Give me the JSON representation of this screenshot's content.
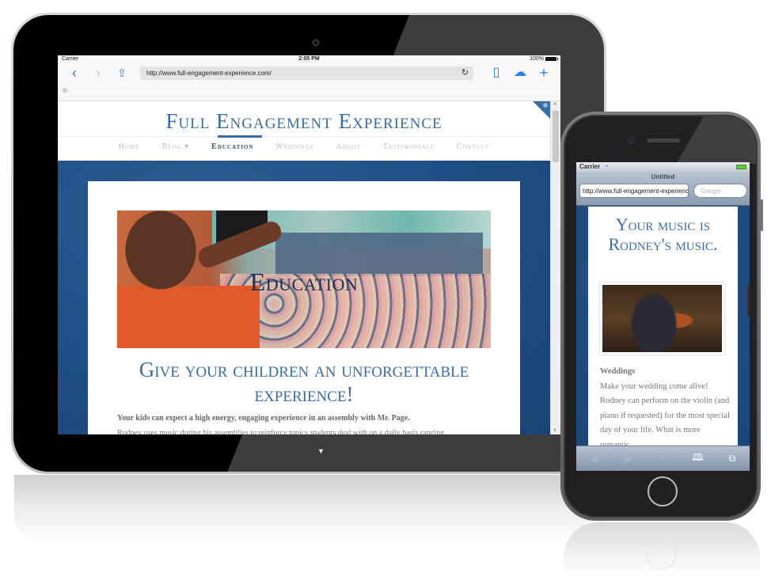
{
  "ipad": {
    "status_bar": {
      "carrier": "Carrier",
      "time": "2:05 PM",
      "battery": "100%"
    },
    "toolbar": {
      "back_icon": "‹",
      "forward_icon": "›",
      "share_icon": "⇪",
      "url": "http://www.full-engagement-experience.com/",
      "reload_icon": "↻",
      "bookmarks_icon": "▯",
      "icloud_icon": "☁",
      "new_tab_icon": "+"
    },
    "tabs_row": {
      "close_icon": "⊗"
    },
    "site": {
      "title": "Full Engagement Experience",
      "nav": [
        "Home",
        "Blog ▾",
        "Education",
        "Weddings",
        "About",
        "Testimonials",
        "Contact"
      ],
      "active_nav": "Education",
      "hero_title": "Education",
      "heading": "Give your children an unforgettable experience!",
      "lead_text": "Your kids can expect a high energy, engaging experience in an assembly with Mr. Page.",
      "body_text": "Rodney uses music during his assemblies to reinforce topics students deal with on a daily basis ranging"
    },
    "scrollbar": {
      "up_icon": "˄",
      "down_icon": "˅"
    },
    "home_arrow": "▼"
  },
  "iphone": {
    "status_bar": {
      "carrier": "Carrier",
      "wifi_icon": "wifi"
    },
    "nav": {
      "title": "Untitled",
      "url": "http://www.full-engagement-experience.com/",
      "search_placeholder": "Google"
    },
    "page": {
      "heading": "Your music is Rodney's music.",
      "subheading": "Weddings",
      "body": "Make your wedding come alive! Rodney can perform on the violin (and piano if requested) for the most special day of your life. What is more romantic"
    },
    "bottom_bar": {
      "back": "◀",
      "forward": "▶",
      "share": "⇗",
      "bookmarks": "🕮",
      "pages": "⧉"
    }
  },
  "colors": {
    "brand_blue": "#3a6ea5",
    "page_bg_blue": "#1f4f86",
    "safari_blue": "#2f7ee8"
  }
}
